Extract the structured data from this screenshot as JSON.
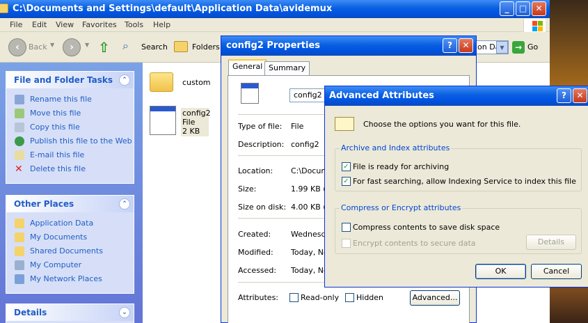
{
  "explorer": {
    "title": "C:\\Documents and Settings\\default\\Application Data\\avidemux",
    "window_buttons": {
      "minimize": "_",
      "maximize": "□",
      "close": "✕"
    },
    "menu": [
      "File",
      "Edit",
      "View",
      "Favorites",
      "Tools",
      "Help"
    ],
    "toolbar": {
      "back": "Back",
      "search": "Search",
      "folders": "Folders",
      "address_value": "on Da",
      "go": "Go"
    }
  },
  "taskpane": {
    "file_tasks": {
      "header": "File and Folder Tasks",
      "items": [
        "Rename this file",
        "Move this file",
        "Copy this file",
        "Publish this file to the Web",
        "E-mail this file",
        "Delete this file"
      ]
    },
    "other_places": {
      "header": "Other Places",
      "items": [
        "Application Data",
        "My Documents",
        "Shared Documents",
        "My Computer",
        "My Network Places"
      ]
    },
    "details": {
      "header": "Details"
    }
  },
  "content": {
    "items": [
      {
        "name": "custom"
      },
      {
        "name": "config2",
        "type": "File",
        "size": "2 KB"
      }
    ]
  },
  "properties": {
    "title": "config2 Properties",
    "tabs": [
      "General",
      "Summary"
    ],
    "file_name": "config2",
    "rows": {
      "type_label": "Type of file:",
      "type_value": "File",
      "desc_label": "Description:",
      "desc_value": "config2",
      "location_label": "Location:",
      "location_value": "C:\\Docum",
      "size_label": "Size:",
      "size_value": "1.99 KB (2",
      "sod_label": "Size on disk:",
      "sod_value": "4.00 KB (4",
      "created_label": "Created:",
      "created_value": "Wednesda",
      "modified_label": "Modified:",
      "modified_value": "Today, No",
      "accessed_label": "Accessed:",
      "accessed_value": "Today, No",
      "attributes_label": "Attributes:"
    },
    "readonly_label": "Read-only",
    "hidden_label": "Hidden",
    "advanced_button": "Advanced...",
    "help_glyph": "?",
    "close_glyph": "✕"
  },
  "advanced": {
    "title": "Advanced Attributes",
    "help_glyph": "?",
    "close_glyph": "✕",
    "intro": "Choose the options you want for this file.",
    "archive_group": {
      "label": "Archive and Index attributes",
      "archive_label": "File is ready for archiving",
      "archive_checked": true,
      "index_label": "For fast searching, allow Indexing Service to index this file",
      "index_checked": true
    },
    "compress_group": {
      "label": "Compress or Encrypt attributes",
      "compress_label": "Compress contents to save disk space",
      "compress_checked": false,
      "encrypt_label": "Encrypt contents to secure data",
      "encrypt_checked": false,
      "details_button": "Details"
    },
    "ok_button": "OK",
    "cancel_button": "Cancel",
    "check_glyph": "✓"
  },
  "colors": {
    "xp_blue": "#0054e3",
    "task_link": "#215dc6",
    "group_label": "#0046d5"
  }
}
